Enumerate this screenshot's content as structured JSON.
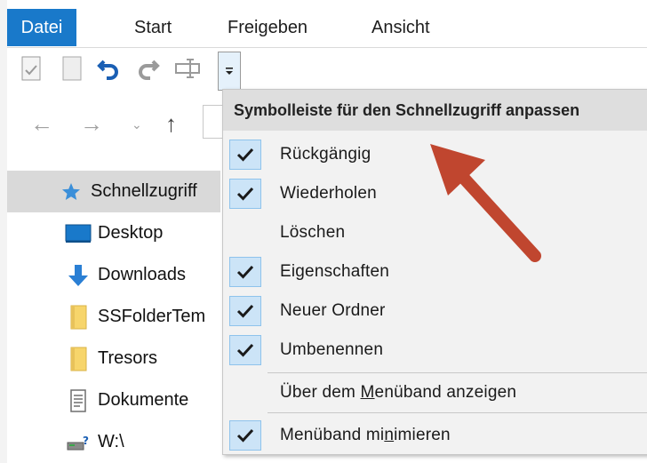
{
  "ribbon": {
    "tabs": [
      "Datei",
      "Start",
      "Freigeben",
      "Ansicht"
    ],
    "active_tab": "Datei",
    "accent_color": "#1979ca"
  },
  "quick_access": {
    "icons": [
      "properties-icon",
      "new-folder-icon",
      "undo-icon",
      "redo-icon",
      "rename-icon",
      "customize-dropdown-icon"
    ]
  },
  "address_bar": {
    "icons": [
      "back-icon",
      "forward-icon",
      "recent-locations-icon",
      "up-icon"
    ]
  },
  "nav_pane": {
    "items": [
      {
        "label": "Schnellzugriff",
        "icon": "star-icon",
        "selected": true
      },
      {
        "label": "Desktop",
        "icon": "desktop-icon"
      },
      {
        "label": "Downloads",
        "icon": "download-icon"
      },
      {
        "label": "SSFolderTem",
        "icon": "folder-icon"
      },
      {
        "label": "Tresors",
        "icon": "folder-icon"
      },
      {
        "label": "Dokumente",
        "icon": "documents-icon"
      },
      {
        "label": "W:\\",
        "icon": "network-drive-icon"
      }
    ]
  },
  "menu": {
    "title": "Symbolleiste für den Schnellzugriff anpassen",
    "items": [
      {
        "label": "Rückgängig",
        "checked": true
      },
      {
        "label": "Wiederholen",
        "checked": true
      },
      {
        "label": "Löschen",
        "checked": false
      },
      {
        "label": "Eigenschaften",
        "checked": true
      },
      {
        "label": "Neuer Ordner",
        "checked": true
      },
      {
        "label": "Umbenennen",
        "checked": true
      }
    ],
    "show_below_pre": "Über dem ",
    "show_below_u": "M",
    "show_below_post": "enüband anzeigen",
    "minimize_pre": "Menüband mi",
    "minimize_u": "n",
    "minimize_post": "imieren",
    "minimize_checked": true
  },
  "annotation": {
    "arrow_color": "#c0462f"
  }
}
